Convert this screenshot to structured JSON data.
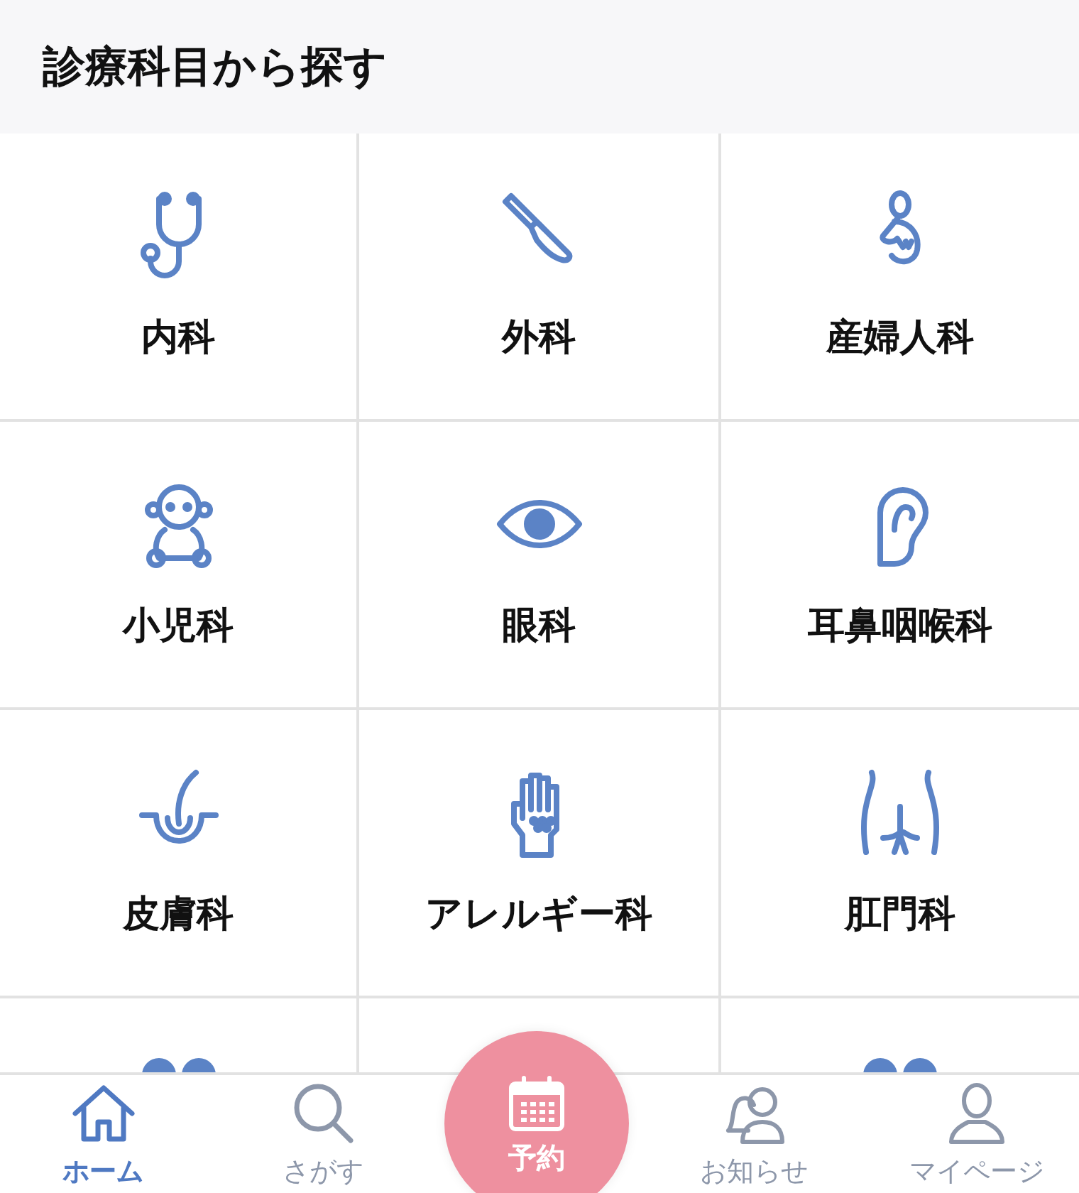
{
  "header": {
    "title": "診療科目から探す"
  },
  "departments": [
    {
      "label": "内科"
    },
    {
      "label": "外科"
    },
    {
      "label": "産婦人科"
    },
    {
      "label": "小児科"
    },
    {
      "label": "眼科"
    },
    {
      "label": "耳鼻咽喉科"
    },
    {
      "label": "皮膚科"
    },
    {
      "label": "アレルギー科"
    },
    {
      "label": "肛門科"
    }
  ],
  "tab_bar": {
    "items": [
      {
        "label": "ホーム",
        "selected": true,
        "kind": "home"
      },
      {
        "label": "さがす",
        "selected": false,
        "kind": "search"
      },
      {
        "label": "予約",
        "selected": false,
        "kind": "reserve"
      },
      {
        "label": "お知らせ",
        "selected": false,
        "kind": "news"
      },
      {
        "label": "マイページ",
        "selected": false,
        "kind": "mypage"
      }
    ]
  }
}
